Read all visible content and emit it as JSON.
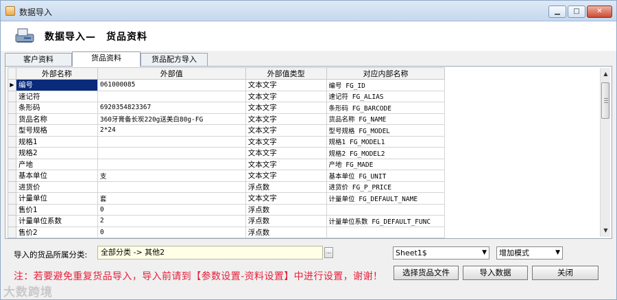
{
  "window": {
    "title": "数据导入",
    "minimize": "▁",
    "maximize": "□",
    "close": "✕"
  },
  "header": {
    "title": "数据导入—　货品资料",
    "icon": "scanner-icon"
  },
  "tabs": [
    {
      "label": "客户资料"
    },
    {
      "label": "货品资料",
      "active": true
    },
    {
      "label": "货品配方导入"
    }
  ],
  "grid": {
    "columns": [
      "外部名称",
      "外部值",
      "外部值类型",
      "对应内部名称"
    ],
    "rows": [
      {
        "name": "编号",
        "value": "061000085",
        "type": "文本文字",
        "internal": "编号 FG_ID"
      },
      {
        "name": "速记符",
        "value": "",
        "type": "文本文字",
        "internal": "速记符 FG_ALIAS"
      },
      {
        "name": "条形码",
        "value": "6920354823367",
        "type": "文本文字",
        "internal": "条形码 FG_BARCODE"
      },
      {
        "name": "货品名称",
        "value": "360牙膏备长炭220g送美白80g-FG",
        "type": "文本文字",
        "internal": "货品名称 FG_NAME"
      },
      {
        "name": "型号规格",
        "value": "2*24",
        "type": "文本文字",
        "internal": "型号规格 FG_MODEL"
      },
      {
        "name": "规格1",
        "value": "",
        "type": "文本文字",
        "internal": "规格1 FG_MODEL1"
      },
      {
        "name": "规格2",
        "value": "",
        "type": "文本文字",
        "internal": "规格2 FG_MODEL2"
      },
      {
        "name": "产地",
        "value": "",
        "type": "文本文字",
        "internal": "产地 FG_MADE"
      },
      {
        "name": "基本单位",
        "value": "支",
        "type": "文本文字",
        "internal": "基本单位 FG_UNIT"
      },
      {
        "name": "进货价",
        "value": "",
        "type": "浮点数",
        "internal": "进货价 FG_P_PRICE"
      },
      {
        "name": "计量单位",
        "value": "套",
        "type": "文本文字",
        "internal": "计量单位 FG_DEFAULT_NAME"
      },
      {
        "name": "售价1",
        "value": "0",
        "type": "浮点数",
        "internal": ""
      },
      {
        "name": "计量单位系数",
        "value": "2",
        "type": "浮点数",
        "internal": "计量单位系数 FG_DEFAULT_FUNC"
      },
      {
        "name": "售价2",
        "value": "0",
        "type": "浮点数",
        "internal": ""
      }
    ]
  },
  "bottom": {
    "category_label": "导入的货品所属分类:",
    "category_value": "全部分类 -> 其他2",
    "ellipsis": "...",
    "sheet_select": "Sheet1$",
    "mode_select": "增加模式",
    "notice": "注：若要避免重复货品导入，导入前请到【参数设置-资料设置】中进行设置，谢谢！",
    "buttons": {
      "choose_file": "选择货品文件",
      "import": "导入数据",
      "close": "关闭"
    }
  },
  "watermark": "大数跨境",
  "colors": {
    "notice": "#e6203a",
    "selected_cell": "#0a2a7a",
    "category_field": "#ffffe8"
  }
}
